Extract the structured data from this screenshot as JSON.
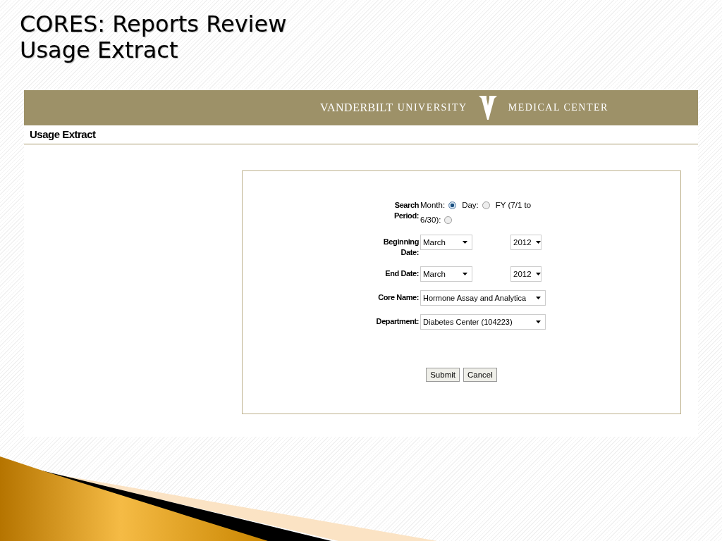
{
  "slide": {
    "title_lines": [
      "CORES: Reports Review",
      "Usage Extract"
    ]
  },
  "banner": {
    "name_bold": "VANDERBILT",
    "name_light": "UNIVERSITY",
    "center": "MEDICAL CENTER"
  },
  "page_heading": "Usage Extract",
  "form": {
    "search_period": {
      "label": "Search Period:",
      "options": [
        {
          "label_lines": [
            "Month:"
          ],
          "selected": true
        },
        {
          "label_lines": [
            "Day:"
          ],
          "selected": false
        },
        {
          "label_lines": [
            "FY (7/1 to",
            "6/30):"
          ],
          "selected": false
        }
      ]
    },
    "date_rows": [
      {
        "label": "Beginning Date:",
        "month": "March",
        "year": "2012"
      },
      {
        "label": "End Date:",
        "month": "March",
        "year": "2012"
      }
    ],
    "select_rows": [
      {
        "label": "Core Name:",
        "value": "Hormone Assay and Analytica"
      },
      {
        "label": "Department:",
        "value": "Diabetes Center (104223)"
      }
    ],
    "buttons": [
      "Submit",
      "Cancel"
    ]
  }
}
